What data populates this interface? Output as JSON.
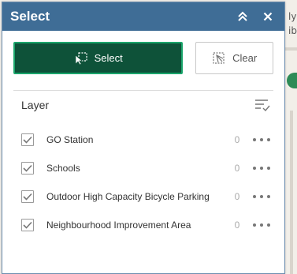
{
  "window": {
    "title": "Select"
  },
  "map_fragments": {
    "top_right_1": "ly",
    "top_right_2": "ib"
  },
  "toolbar": {
    "select_label": "Select",
    "clear_label": "Clear"
  },
  "layer_section": {
    "title": "Layer"
  },
  "layers": [
    {
      "name": "GO Station",
      "count": "0",
      "checked": true
    },
    {
      "name": "Schools",
      "count": "0",
      "checked": true
    },
    {
      "name": "Outdoor High Capacity Bicycle Parking",
      "count": "0",
      "checked": true
    },
    {
      "name": "Neighbourhood Improvement Area",
      "count": "0",
      "checked": true
    }
  ],
  "colors": {
    "titlebar": "#3f6d96",
    "select_button": "#0e5239",
    "select_border": "#1aa56b"
  },
  "icons": {
    "collapse": "double-chevron-up-icon",
    "close": "close-icon",
    "select": "select-cursor-icon",
    "clear": "clear-selection-icon",
    "sort": "sort-list-icon",
    "checkbox": "checkmark-icon",
    "more": "more-options-icon"
  }
}
